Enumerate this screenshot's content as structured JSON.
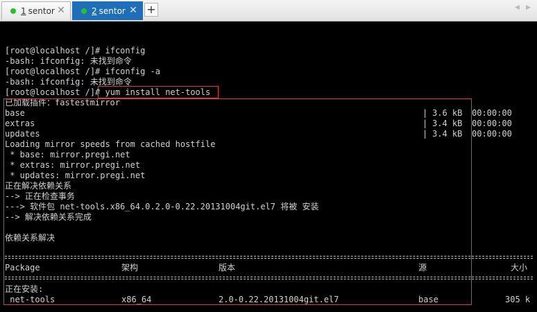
{
  "tabs": [
    {
      "number": "1",
      "name": "sentor",
      "status_color": "#27c327",
      "active": false
    },
    {
      "number": "2",
      "name": "sentor",
      "status_color": "#27c327",
      "active": true
    }
  ],
  "add_tab_label": "+",
  "close_glyph": "✕",
  "nav_prev": "◀",
  "nav_next": "▶",
  "terminal": {
    "lines": [
      "[root@localhost /]# ifconfig",
      "-bash: ifconfig: 未找到命令",
      "[root@localhost /]# ifconfig -a",
      "-bash: ifconfig: 未找到命令"
    ],
    "prompt": "[root@localhost /]# ",
    "command": "yum install net-tools",
    "output_lines": [
      "已加载插件：fastestmirror"
    ],
    "repos": [
      {
        "name": "base",
        "size": "3.6 kB",
        "time": "00:00:00"
      },
      {
        "name": "extras",
        "size": "3.4 kB",
        "time": "00:00:00"
      },
      {
        "name": "updates",
        "size": "3.4 kB",
        "time": "00:00:00"
      }
    ],
    "mirror_lines": [
      "Loading mirror speeds from cached hostfile",
      " * base: mirror.pregi.net",
      " * extras: mirror.pregi.net",
      " * updates: mirror.pregi.net",
      "正在解决依赖关系",
      "--> 正在检查事务",
      "---> 软件包 net-tools.x86_64.0.2.0-0.22.20131004git.el7 将被 安装",
      "--> 解决依赖关系完成",
      "",
      "依赖关系解决"
    ],
    "table": {
      "headers": {
        "package": "Package",
        "arch": "架构",
        "version": "版本",
        "repo": "源",
        "size": "大小"
      },
      "section": "正在安装:",
      "row": {
        "package": " net-tools",
        "arch": "x86_64",
        "version": "2.0-0.22.20131004git.el7",
        "repo": "base",
        "size": "305 k"
      }
    }
  },
  "highlight_color": "#e23b3b"
}
